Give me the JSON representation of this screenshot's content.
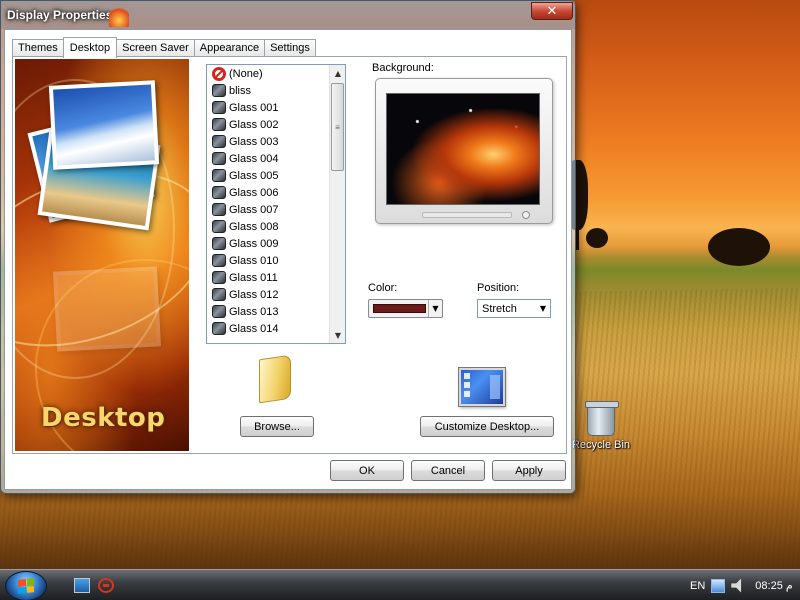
{
  "window": {
    "title": "Display Properties",
    "close_label": "✕"
  },
  "tabs": [
    {
      "label": "Themes"
    },
    {
      "label": "Desktop",
      "active": true
    },
    {
      "label": "Screen Saver"
    },
    {
      "label": "Appearance"
    },
    {
      "label": "Settings"
    }
  ],
  "art": {
    "caption": "Desktop"
  },
  "wallpaper_list": {
    "items": [
      {
        "label": "(None)",
        "icon": "none-icon"
      },
      {
        "label": "bliss",
        "icon": "image-icon"
      },
      {
        "label": "Glass 001",
        "icon": "image-icon"
      },
      {
        "label": "Glass 002",
        "icon": "image-icon"
      },
      {
        "label": "Glass 003",
        "icon": "image-icon"
      },
      {
        "label": "Glass 004",
        "icon": "image-icon"
      },
      {
        "label": "Glass 005",
        "icon": "image-icon"
      },
      {
        "label": "Glass 006",
        "icon": "image-icon"
      },
      {
        "label": "Glass 007",
        "icon": "image-icon"
      },
      {
        "label": "Glass 008",
        "icon": "image-icon"
      },
      {
        "label": "Glass 009",
        "icon": "image-icon"
      },
      {
        "label": "Glass 010",
        "icon": "image-icon"
      },
      {
        "label": "Glass 011",
        "icon": "image-icon"
      },
      {
        "label": "Glass 012",
        "icon": "image-icon"
      },
      {
        "label": "Glass 013",
        "icon": "image-icon"
      },
      {
        "label": "Glass 014",
        "icon": "image-icon"
      }
    ]
  },
  "background": {
    "label": "Background:"
  },
  "color": {
    "label": "Color:",
    "value": "#6b1a1a"
  },
  "position": {
    "label": "Position:",
    "value": "Stretch"
  },
  "buttons": {
    "browse": "Browse...",
    "customize": "Customize Desktop...",
    "ok": "OK",
    "cancel": "Cancel",
    "apply": "Apply"
  },
  "desktop": {
    "recycle_bin_label": "Recycle Bin"
  },
  "taskbar": {
    "language": "EN",
    "clock": "08:25 م"
  }
}
